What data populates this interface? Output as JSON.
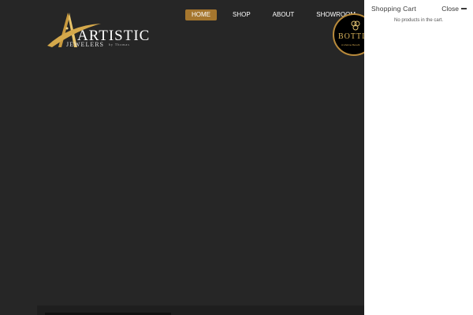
{
  "logo": {
    "main": "ARTISTIC",
    "sub": "JEWELERS",
    "tag": "by Thomas"
  },
  "nav": {
    "items": [
      {
        "label": "HOME",
        "active": true
      },
      {
        "label": "SHOP",
        "active": false
      },
      {
        "label": "ABOUT",
        "active": false
      },
      {
        "label": "SHOWROOM",
        "active": false
      }
    ]
  },
  "badge": {
    "text": "BOTTLE",
    "sub": "A Lifetime Benefit"
  },
  "cart": {
    "title": "Shopping Cart",
    "close_label": "Close",
    "empty_message": "No products in the cart."
  },
  "colors": {
    "background": "#262626",
    "accent": "#a5762e",
    "panel": "#ffffff"
  }
}
